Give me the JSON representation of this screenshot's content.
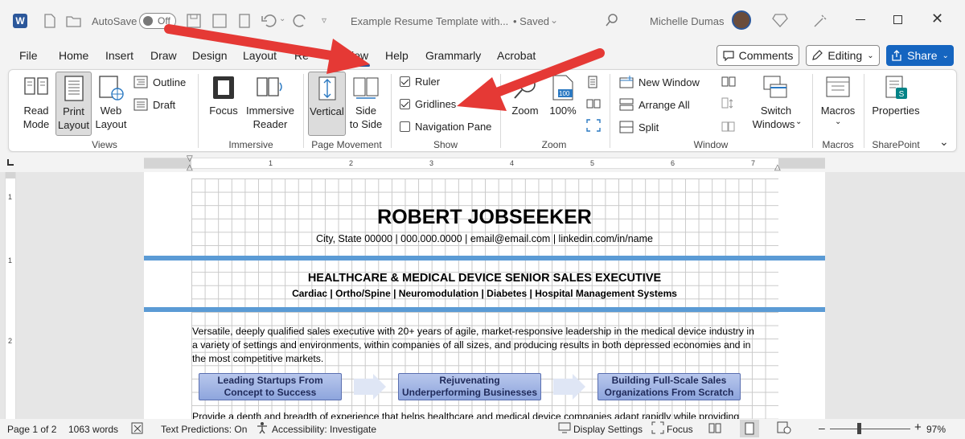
{
  "titlebar": {
    "autosave_label": "AutoSave",
    "autosave_state": "Off",
    "doc_title": "Example Resume Template with...",
    "saved_status": "• Saved",
    "user_name": "Michelle Dumas"
  },
  "menu": {
    "items": [
      "File",
      "Home",
      "Insert",
      "Draw",
      "Design",
      "Layout",
      "Re",
      "View",
      "Help",
      "Grammarly",
      "Acrobat"
    ],
    "active": "View",
    "comments_label": "Comments",
    "editing_label": "Editing",
    "share_label": "Share"
  },
  "ribbon": {
    "views": {
      "read_mode": [
        "Read",
        "Mode"
      ],
      "print_layout": [
        "Print",
        "Layout"
      ],
      "web_layout": [
        "Web",
        "Layout"
      ],
      "outline": "Outline",
      "draft": "Draft",
      "group_label": "Views"
    },
    "immersive": {
      "focus": "Focus",
      "immersive_reader": [
        "Immersive",
        "Reader"
      ],
      "group_label": "Immersive"
    },
    "page_movement": {
      "vertical": "Vertical",
      "side_to_side": [
        "Side",
        "to Side"
      ],
      "group_label": "Page Movement"
    },
    "show": {
      "ruler": {
        "label": "Ruler",
        "checked": true
      },
      "gridlines": {
        "label": "Gridlines",
        "checked": true
      },
      "navigation_pane": {
        "label": "Navigation Pane",
        "checked": false
      },
      "group_label": "Show"
    },
    "zoom": {
      "zoom": "Zoom",
      "hundred": "100%",
      "icon_text": "100",
      "group_label": "Zoom"
    },
    "window": {
      "new_window": "New Window",
      "arrange_all": "Arrange All",
      "split": "Split",
      "switch_windows": [
        "Switch",
        "Windows"
      ],
      "group_label": "Window"
    },
    "macros": {
      "label": "Macros",
      "group_label": "Macros"
    },
    "sharepoint": {
      "label": "Properties",
      "group_label": "SharePoint"
    }
  },
  "ruler": {
    "numbers": [
      "1",
      "1",
      "2",
      "3",
      "4",
      "5",
      "6",
      "7"
    ],
    "vertical_numbers": [
      "1",
      "1",
      "2"
    ]
  },
  "document": {
    "name": "ROBERT JOBSEEKER",
    "contact": "City, State 00000 | 000.000.0000 | email@email.com | linkedin.com/in/name",
    "headline": "HEALTHCARE & MEDICAL DEVICE SENIOR SALES EXECUTIVE",
    "specialties": "Cardiac  | Ortho/Spine  | Neuromodulation | Diabetes | Hospital Management Systems",
    "summary_lines": [
      "Versatile, deeply qualified sales executive with 20+ years of agile, market-responsive leadership in the medical device industry in",
      "a variety of settings and environments, within companies of all sizes, and producing results in both depressed economies and in",
      "the most competitive markets."
    ],
    "boxes": [
      [
        "Leading Startups From",
        "Concept to Success"
      ],
      [
        "Rejuvenating",
        "Underperforming Businesses"
      ],
      [
        "Building Full-Scale Sales",
        "Organizations From Scratch"
      ]
    ],
    "cut_line": "Provide a depth and breadth of experience that helps healthcare and medical device companies adapt rapidly while providing"
  },
  "status": {
    "page": "Page 1 of 2",
    "words": "1063 words",
    "text_predictions": "Text Predictions: On",
    "accessibility": "Accessibility: Investigate",
    "display_settings": "Display Settings",
    "focus": "Focus",
    "zoom": "97%"
  },
  "colors": {
    "accent_blue": "#2b579a",
    "share_blue": "#1565c0",
    "arrow_red": "#e53935",
    "rule_blue": "#5b9bd5"
  }
}
